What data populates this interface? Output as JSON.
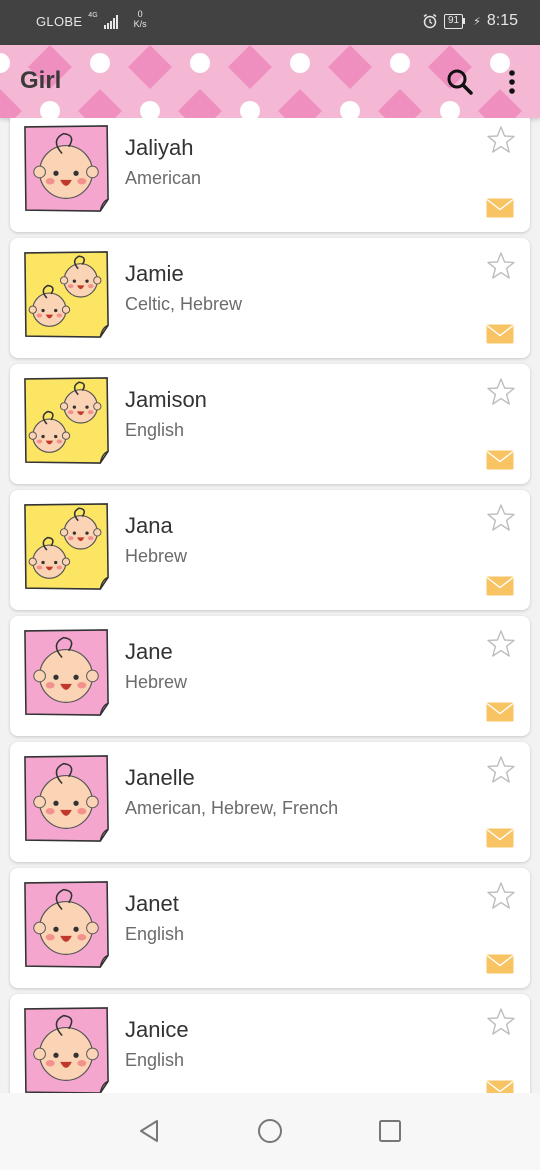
{
  "status_bar": {
    "carrier": "GLOBE",
    "network": "4G",
    "speed_value": "0",
    "speed_unit": "K/s",
    "battery": "91",
    "time": "8:15"
  },
  "app_bar": {
    "title": "Girl",
    "search_icon": "search-icon",
    "more_icon": "more-vert-icon",
    "pattern_colors": [
      "#f5b8d4",
      "#ef8fc0",
      "#ffffff"
    ]
  },
  "names": [
    {
      "name": "Jaliyah",
      "origin": "American",
      "avatar": "girl",
      "starred": false
    },
    {
      "name": "Jamie",
      "origin": "Celtic, Hebrew",
      "avatar": "twins",
      "starred": false
    },
    {
      "name": "Jamison",
      "origin": "English",
      "avatar": "twins",
      "starred": false
    },
    {
      "name": "Jana",
      "origin": "Hebrew",
      "avatar": "twins",
      "starred": false
    },
    {
      "name": "Jane",
      "origin": "Hebrew",
      "avatar": "girl",
      "starred": false
    },
    {
      "name": "Janelle",
      "origin": "American, Hebrew, French",
      "avatar": "girl",
      "starred": false
    },
    {
      "name": "Janet",
      "origin": "English",
      "avatar": "girl",
      "starred": false
    },
    {
      "name": "Janice",
      "origin": "English",
      "avatar": "girl",
      "starred": false
    }
  ],
  "colors": {
    "girl_note": "#f4a6cf",
    "twins_note": "#fbe563",
    "face": "#fbd3b5",
    "mail": "#f8c463"
  },
  "nav_bar": {
    "back_icon": "back-triangle-icon",
    "home_icon": "home-circle-icon",
    "recent_icon": "recent-square-icon"
  }
}
